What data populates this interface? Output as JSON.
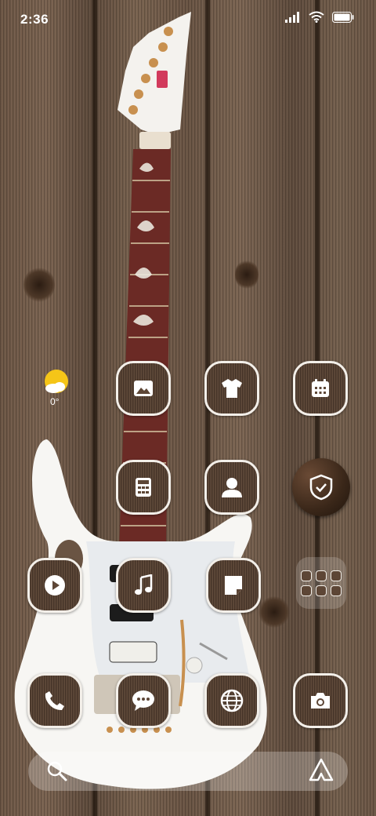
{
  "status_bar": {
    "time": "2:36",
    "icons": [
      "signal-icon",
      "wifi-icon",
      "battery-icon"
    ]
  },
  "weather_widget": {
    "icon": "partly-sunny-icon",
    "temperature": "0°"
  },
  "apps": {
    "row1": [
      "gallery-icon",
      "themes-icon",
      "calendar-icon"
    ],
    "row2": [
      "calculator-icon",
      "contacts-icon",
      "security-icon"
    ],
    "row3": [
      "video-player-icon",
      "music-icon",
      "notes-icon",
      "app-folder"
    ],
    "dock": [
      "phone-icon",
      "messages-icon",
      "browser-icon",
      "camera-icon"
    ]
  },
  "search": {
    "icons": [
      "search-icon",
      "assistant-icon"
    ]
  },
  "colors": {
    "icon_border": "#f3efe9",
    "icon_fill": "#5d4636",
    "weather_sun": "#f5c518"
  }
}
